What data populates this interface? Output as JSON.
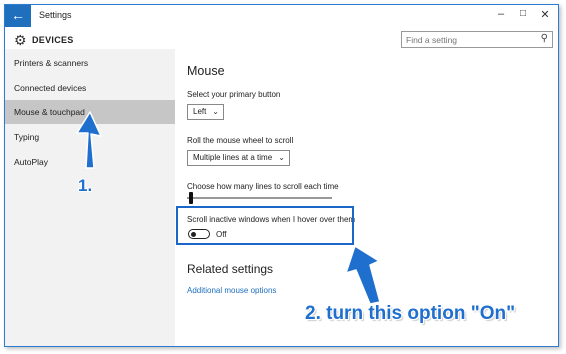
{
  "window": {
    "title": "Settings",
    "controls": {
      "minimize": "–",
      "maximize": "□",
      "close": "✕"
    }
  },
  "header": {
    "icon": "gear-icon",
    "title": "DEVICES",
    "search_placeholder": "Find a setting"
  },
  "sidebar": {
    "items": [
      {
        "label": "Printers & scanners",
        "selected": false
      },
      {
        "label": "Connected devices",
        "selected": false
      },
      {
        "label": "Mouse & touchpad",
        "selected": true
      },
      {
        "label": "Typing",
        "selected": false
      },
      {
        "label": "AutoPlay",
        "selected": false
      }
    ]
  },
  "main": {
    "heading": "Mouse",
    "primary_button_label": "Select your primary button",
    "primary_button_value": "Left",
    "scroll_wheel_label": "Roll the mouse wheel to scroll",
    "scroll_wheel_value": "Multiple lines at a time",
    "lines_label": "Choose how many lines to scroll each time",
    "lines_slider_level": 0.03,
    "inactive_scroll_label": "Scroll inactive windows when I hover over them",
    "inactive_scroll_state": "Off",
    "related_heading": "Related settings",
    "additional_link": "Additional mouse options"
  },
  "annotations": {
    "step1": "1.",
    "step2": "2. turn this option \"On\"",
    "color": "#1f6fce"
  },
  "colors": {
    "accent": "#1f6fbd",
    "sidebar_bg": "#f2f2f2",
    "sidebar_selected": "#c6c6c6"
  }
}
